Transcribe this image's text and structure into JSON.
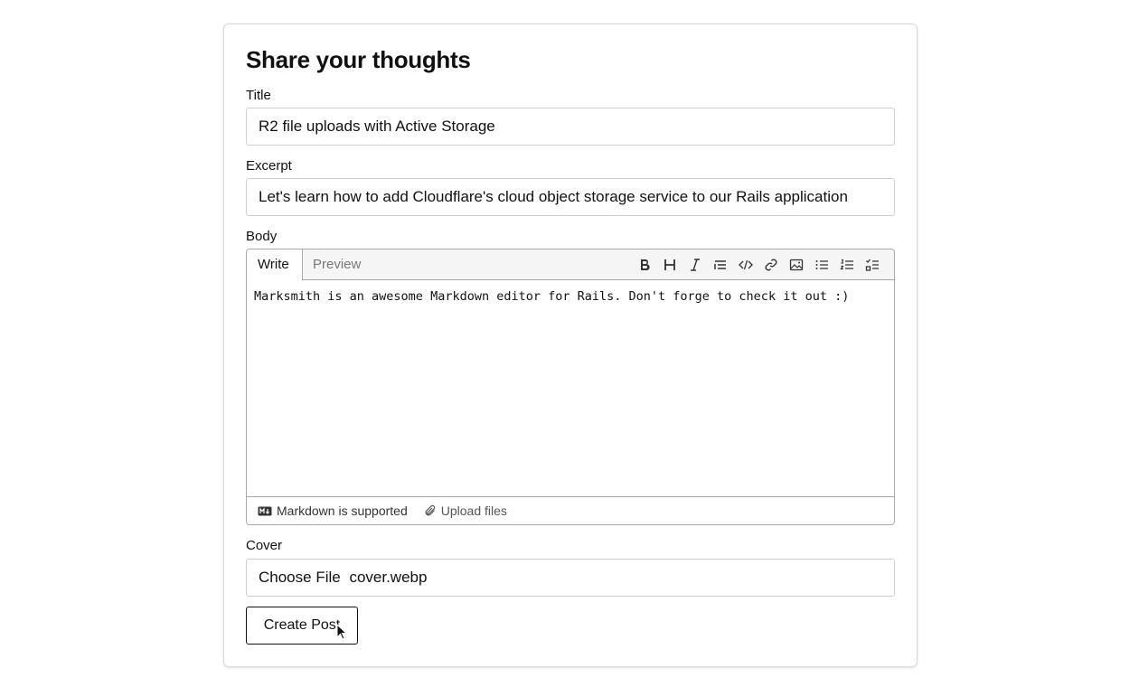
{
  "form": {
    "heading": "Share your thoughts",
    "title_label": "Title",
    "title_value": "R2 file uploads with Active Storage",
    "excerpt_label": "Excerpt",
    "excerpt_value": "Let's learn how to add Cloudflare's cloud object storage service to our Rails application",
    "body_label": "Body",
    "cover_label": "Cover",
    "cover_button": "Choose File",
    "cover_filename": "cover.webp",
    "submit_label": "Create Post"
  },
  "editor": {
    "tabs": [
      {
        "label": "Write",
        "active": true
      },
      {
        "label": "Preview",
        "active": false
      }
    ],
    "toolbar_icons": [
      "bold-icon",
      "heading-icon",
      "italic-icon",
      "quote-icon",
      "code-icon",
      "link-icon",
      "image-icon",
      "bullet-list-icon",
      "numbered-list-icon",
      "task-list-icon"
    ],
    "body_text": "Marksmith is an awesome Markdown editor for Rails. Don't forge to check it out :)",
    "footer_markdown": "Markdown is supported",
    "footer_upload": "Upload files"
  },
  "colors": {
    "border": "#cfcfcf",
    "editor_border": "#a8a8a8",
    "toolbar_bg": "#f5f5f5",
    "text": "#111111",
    "muted": "#777777"
  }
}
